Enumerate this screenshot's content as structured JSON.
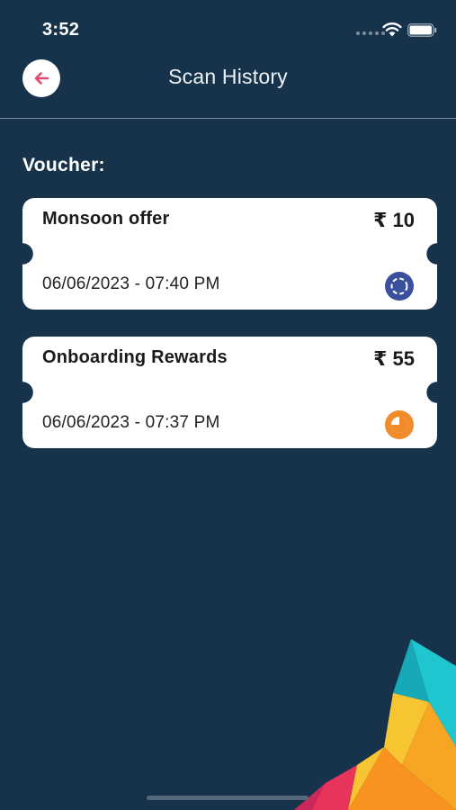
{
  "status_bar": {
    "time": "3:52"
  },
  "header": {
    "title": "Scan History",
    "back_icon": "arrow-left-icon"
  },
  "section": {
    "label": "Voucher:"
  },
  "vouchers": [
    {
      "title": "Monsoon offer",
      "amount": "₹ 10",
      "date": "06/06/2023 - 07:40 PM",
      "status_icon": "processing-icon",
      "status_color": "#3a4f9e"
    },
    {
      "title": "Onboarding Rewards",
      "amount": "₹ 55",
      "date": "06/06/2023 - 07:37 PM",
      "status_icon": "pending-pie-icon",
      "status_color": "#f08b2a"
    }
  ],
  "colors": {
    "background": "#17334c",
    "accent": "#e8476d",
    "card": "#ffffff"
  }
}
